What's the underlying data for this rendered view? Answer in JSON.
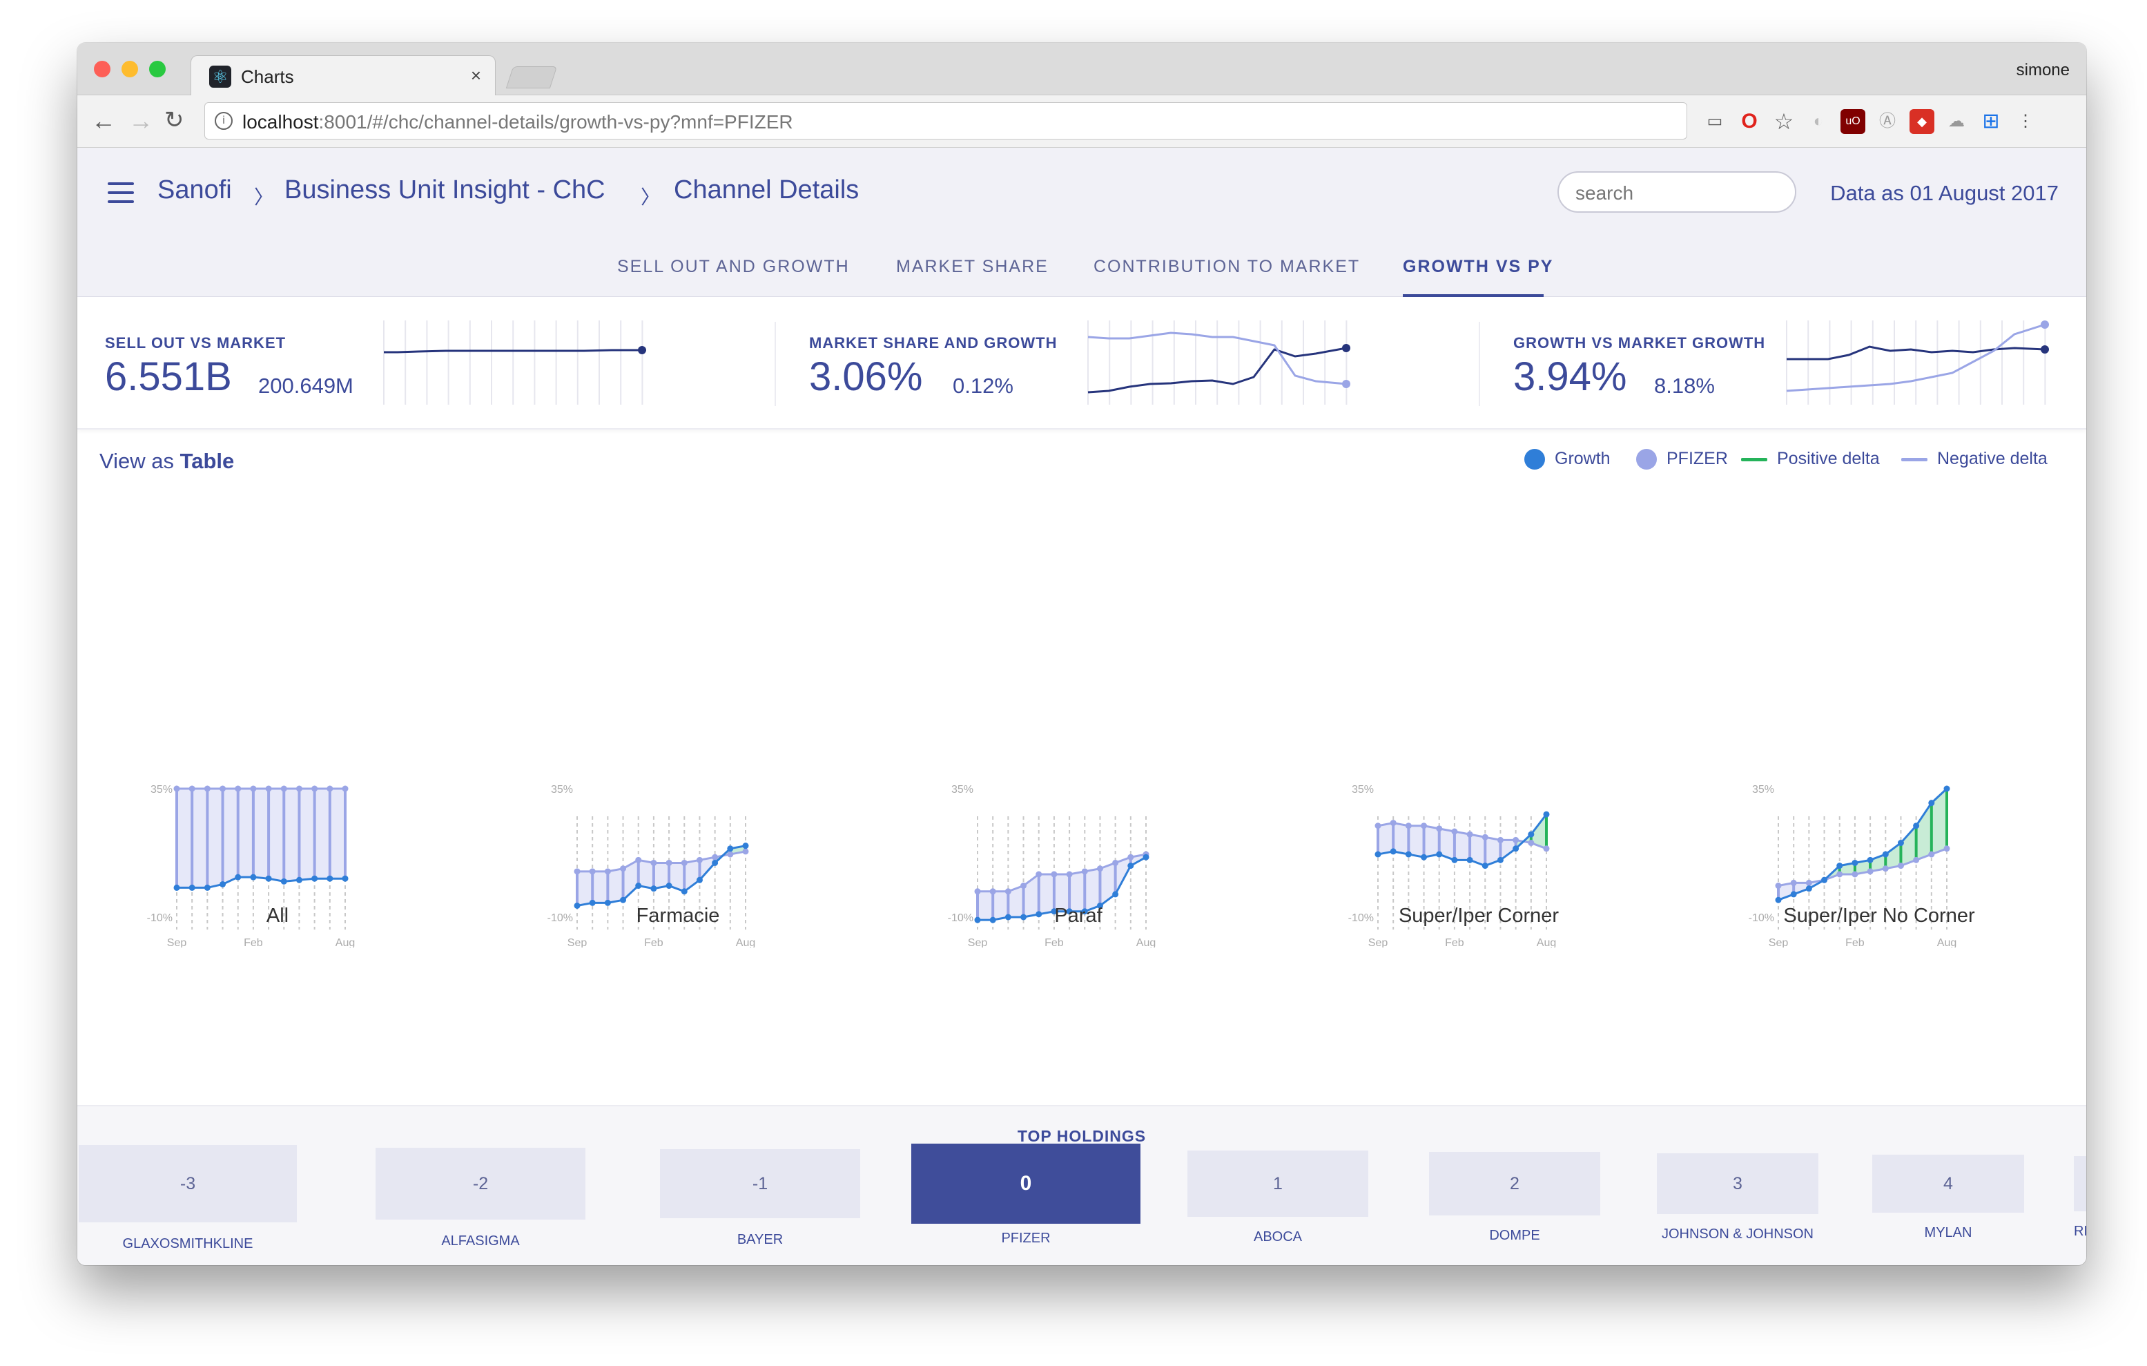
{
  "browser": {
    "tab_title": "Charts",
    "tab_close": "×",
    "user": "simone",
    "url_host": "localhost",
    "url_rest": ":8001/#/chc/channel-details/growth-vs-py?mnf=PFIZER"
  },
  "header": {
    "breadcrumbs": [
      "Sanofi",
      "Business Unit Insight - ChC",
      "Channel Details"
    ],
    "separator": "〉",
    "search_placeholder": "search",
    "data_as": "Data as 01 August 2017"
  },
  "tabs": [
    "SELL OUT AND GROWTH",
    "MARKET SHARE",
    "CONTRIBUTION TO MARKET",
    "GROWTH VS PY"
  ],
  "active_tab": "GROWTH VS PY",
  "kpis": [
    {
      "label": "SELL OUT VS MARKET",
      "main": "6.551B",
      "sub": "200.649M"
    },
    {
      "label": "MARKET SHARE AND GROWTH",
      "main": "3.06%",
      "sub": "0.12%"
    },
    {
      "label": "GROWTH VS MARKET GROWTH",
      "main": "3.94%",
      "sub": "8.18%"
    }
  ],
  "view_as": {
    "prefix": "View as",
    "mode": "Table"
  },
  "legend": [
    {
      "label": "Growth",
      "color": "#2f7ed8",
      "kind": "dot"
    },
    {
      "label": "PFIZER",
      "color": "#9aa5e6",
      "kind": "dot"
    },
    {
      "label": "Positive delta",
      "color": "#25b35a",
      "kind": "line"
    },
    {
      "label": "Negative delta",
      "color": "#9aa5e6",
      "kind": "line"
    }
  ],
  "colors": {
    "primary": "#3c4a9a",
    "growth": "#2f7ed8",
    "pfizer": "#9aa5e6",
    "positive": "#25b35a"
  },
  "chart_data": [
    {
      "type": "line",
      "title": "All",
      "ylim": [
        -10,
        35
      ],
      "yticks": [
        "35%",
        "-10%"
      ],
      "xticks": [
        "Sep",
        "Feb",
        "Aug"
      ],
      "series": [
        {
          "name": "Growth",
          "values": [
            0.3,
            0.3,
            0.3,
            1.5,
            4,
            4,
            3.5,
            2.5,
            3,
            3.5,
            3.5,
            3.5
          ]
        },
        {
          "name": "PFIZER",
          "values": [
            35,
            35,
            35,
            35,
            35,
            35,
            35,
            35,
            35,
            35,
            35,
            35
          ]
        }
      ]
    },
    {
      "type": "line",
      "title": "Farmacie",
      "ylim": [
        -10,
        35
      ],
      "yticks": [
        "35%",
        "-10%"
      ],
      "xticks": [
        "Sep",
        "Feb",
        "Aug"
      ],
      "series": [
        {
          "name": "Growth",
          "values": [
            -6,
            -5,
            -5,
            -4,
            1,
            0,
            1,
            -1,
            3,
            9,
            14,
            15
          ]
        },
        {
          "name": "PFIZER",
          "values": [
            6,
            6,
            6,
            7,
            10,
            9,
            9,
            9,
            10,
            11,
            12,
            13
          ]
        }
      ]
    },
    {
      "type": "line",
      "title": "Paraf",
      "ylim": [
        -10,
        35
      ],
      "yticks": [
        "35%",
        "-10%"
      ],
      "xticks": [
        "Sep",
        "Feb",
        "Aug"
      ],
      "series": [
        {
          "name": "Growth",
          "values": [
            -11,
            -11,
            -10,
            -10,
            -9,
            -8,
            -8,
            -8,
            -6,
            -2,
            8,
            11
          ]
        },
        {
          "name": "PFIZER",
          "values": [
            -1,
            -1,
            -1,
            1,
            5,
            5,
            5,
            6,
            7,
            9,
            11,
            12
          ]
        }
      ]
    },
    {
      "type": "line",
      "title": "Super/Iper Corner",
      "ylim": [
        -10,
        35
      ],
      "yticks": [
        "35%",
        "-10%"
      ],
      "xticks": [
        "Sep",
        "Feb",
        "Aug"
      ],
      "series": [
        {
          "name": "Growth",
          "values": [
            12,
            13,
            12,
            11,
            12,
            10,
            10,
            8,
            10,
            14,
            19,
            26
          ]
        },
        {
          "name": "PFIZER",
          "values": [
            22,
            23,
            22,
            22,
            21,
            20,
            19,
            18,
            17,
            17,
            16,
            14
          ]
        }
      ]
    },
    {
      "type": "line",
      "title": "Super/Iper No Corner",
      "ylim": [
        -10,
        35
      ],
      "yticks": [
        "35%",
        "-10%"
      ],
      "xticks": [
        "Sep",
        "Feb",
        "Aug"
      ],
      "series": [
        {
          "name": "Growth",
          "values": [
            -4,
            -2,
            0,
            3,
            8,
            9,
            10,
            12,
            16,
            22,
            30,
            35
          ]
        },
        {
          "name": "PFIZER",
          "values": [
            1,
            2,
            2,
            3,
            5,
            5,
            6,
            7,
            8,
            10,
            12,
            14
          ]
        }
      ]
    }
  ],
  "top_holdings": {
    "title": "TOP HOLDINGS",
    "items": [
      {
        "rank": "-3",
        "name": "GLAXOSMITHKLINE"
      },
      {
        "rank": "-2",
        "name": "ALFASIGMA"
      },
      {
        "rank": "-1",
        "name": "BAYER"
      },
      {
        "rank": "0",
        "name": "PFIZER"
      },
      {
        "rank": "1",
        "name": "ABOCA"
      },
      {
        "rank": "2",
        "name": "DOMPE"
      },
      {
        "rank": "3",
        "name": "JOHNSON & JOHNSON"
      },
      {
        "rank": "4",
        "name": "MYLAN"
      },
      {
        "rank": "",
        "name": "RE"
      }
    ]
  }
}
